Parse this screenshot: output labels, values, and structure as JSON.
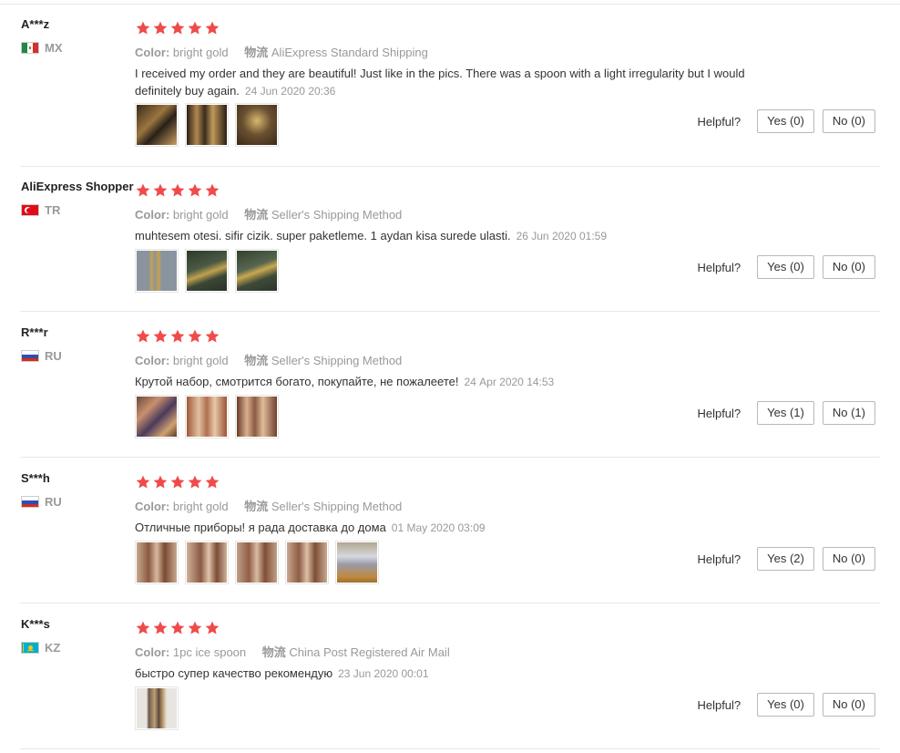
{
  "labels": {
    "color_key": "Color:",
    "shipping_key": "物流",
    "helpful": "Helpful?"
  },
  "colors": {
    "star": "#f04a4a",
    "muted_text": "#999999",
    "divider": "#e8e8e8"
  },
  "reviews": [
    {
      "name": "A***z",
      "country": "MX",
      "flag_icon": "mexico-flag-icon",
      "rating": 5,
      "color_value": "bright gold",
      "shipping_value": "AliExpress Standard Shipping",
      "comment": "I received my order and they are beautiful! Just like in the pics. There was a spoon with a light irregularity but I would definitely buy again.",
      "date": "24 Jun 2020 20:36",
      "yes": "Yes (0)",
      "no": "No (0)",
      "photos": [
        "photo-1",
        "photo-2",
        "photo-3"
      ]
    },
    {
      "name": "AliExpress Shopper",
      "country": "TR",
      "flag_icon": "turkey-flag-icon",
      "rating": 5,
      "color_value": "bright gold",
      "shipping_value": "Seller's Shipping Method",
      "comment": "muhtesem otesi. sifir cizik. super paketleme. 1 aydan kisa surede ulasti.",
      "date": "26 Jun 2020 01:59",
      "yes": "Yes (0)",
      "no": "No (0)",
      "photos": [
        "photo-1",
        "photo-2",
        "photo-3"
      ]
    },
    {
      "name": "R***r",
      "country": "RU",
      "flag_icon": "russia-flag-icon",
      "rating": 5,
      "color_value": "bright gold",
      "shipping_value": "Seller's Shipping Method",
      "comment": "Крутой набор, смотрится богато, покупайте, не пожалеете!",
      "date": "24 Apr 2020 14:53",
      "yes": "Yes (1)",
      "no": "No (1)",
      "photos": [
        "photo-1",
        "photo-2",
        "photo-3"
      ]
    },
    {
      "name": "S***h",
      "country": "RU",
      "flag_icon": "russia-flag-icon",
      "rating": 5,
      "color_value": "bright gold",
      "shipping_value": "Seller's Shipping Method",
      "comment": "Отличные приборы! я рада доставка до дома",
      "date": "01 May 2020 03:09",
      "yes": "Yes (2)",
      "no": "No (0)",
      "photos": [
        "photo-1",
        "photo-2",
        "photo-3",
        "photo-4",
        "photo-5"
      ]
    },
    {
      "name": "K***s",
      "country": "KZ",
      "flag_icon": "kazakhstan-flag-icon",
      "rating": 5,
      "color_value": "1pc ice spoon",
      "shipping_value": "China Post Registered Air Mail",
      "comment": "быстро супер качество рекомендую",
      "date": "23 Jun 2020 00:01",
      "yes": "Yes (0)",
      "no": "No (0)",
      "photos": [
        "photo-1"
      ]
    }
  ]
}
